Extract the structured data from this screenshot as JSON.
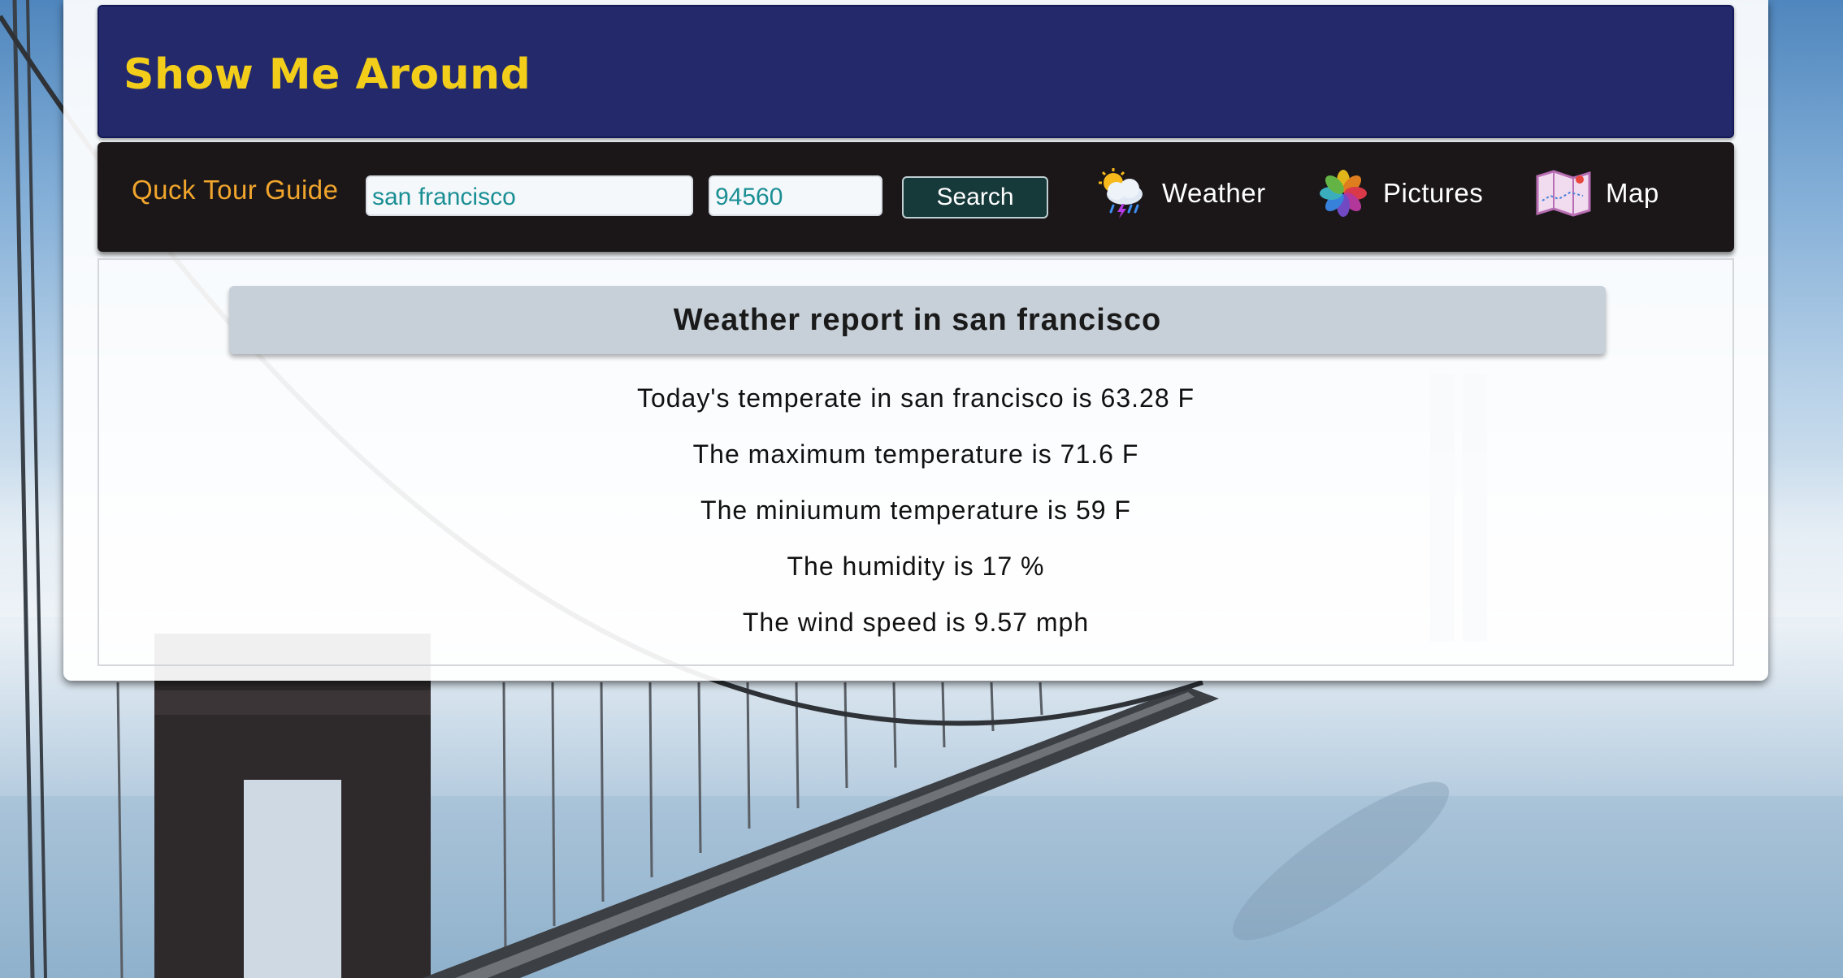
{
  "header": {
    "title": "Show Me Around"
  },
  "navbar": {
    "brand": "Quck Tour Guide",
    "city_value": "san francisco",
    "zip_value": "94560",
    "search_label": "Search",
    "links": [
      {
        "label": "Weather",
        "icon": "weather-icon"
      },
      {
        "label": "Pictures",
        "icon": "photos-icon"
      },
      {
        "label": "Map",
        "icon": "map-icon"
      }
    ]
  },
  "report": {
    "title": "Weather report in san francisco",
    "lines": [
      "Today's temperate in san francisco is 63.28 F",
      "The maximum temperature is 71.6 F",
      "The miniumum temperature is 59 F",
      "The humidity is 17 %",
      "The wind speed is 9.57 mph"
    ]
  },
  "colors": {
    "header_bg": "#181e64",
    "title_yellow": "#f2ce1a",
    "brand_orange": "#f1a52c",
    "input_text": "#1a8f94",
    "search_bg": "#16393a",
    "report_bar": "#c7d0d8"
  }
}
